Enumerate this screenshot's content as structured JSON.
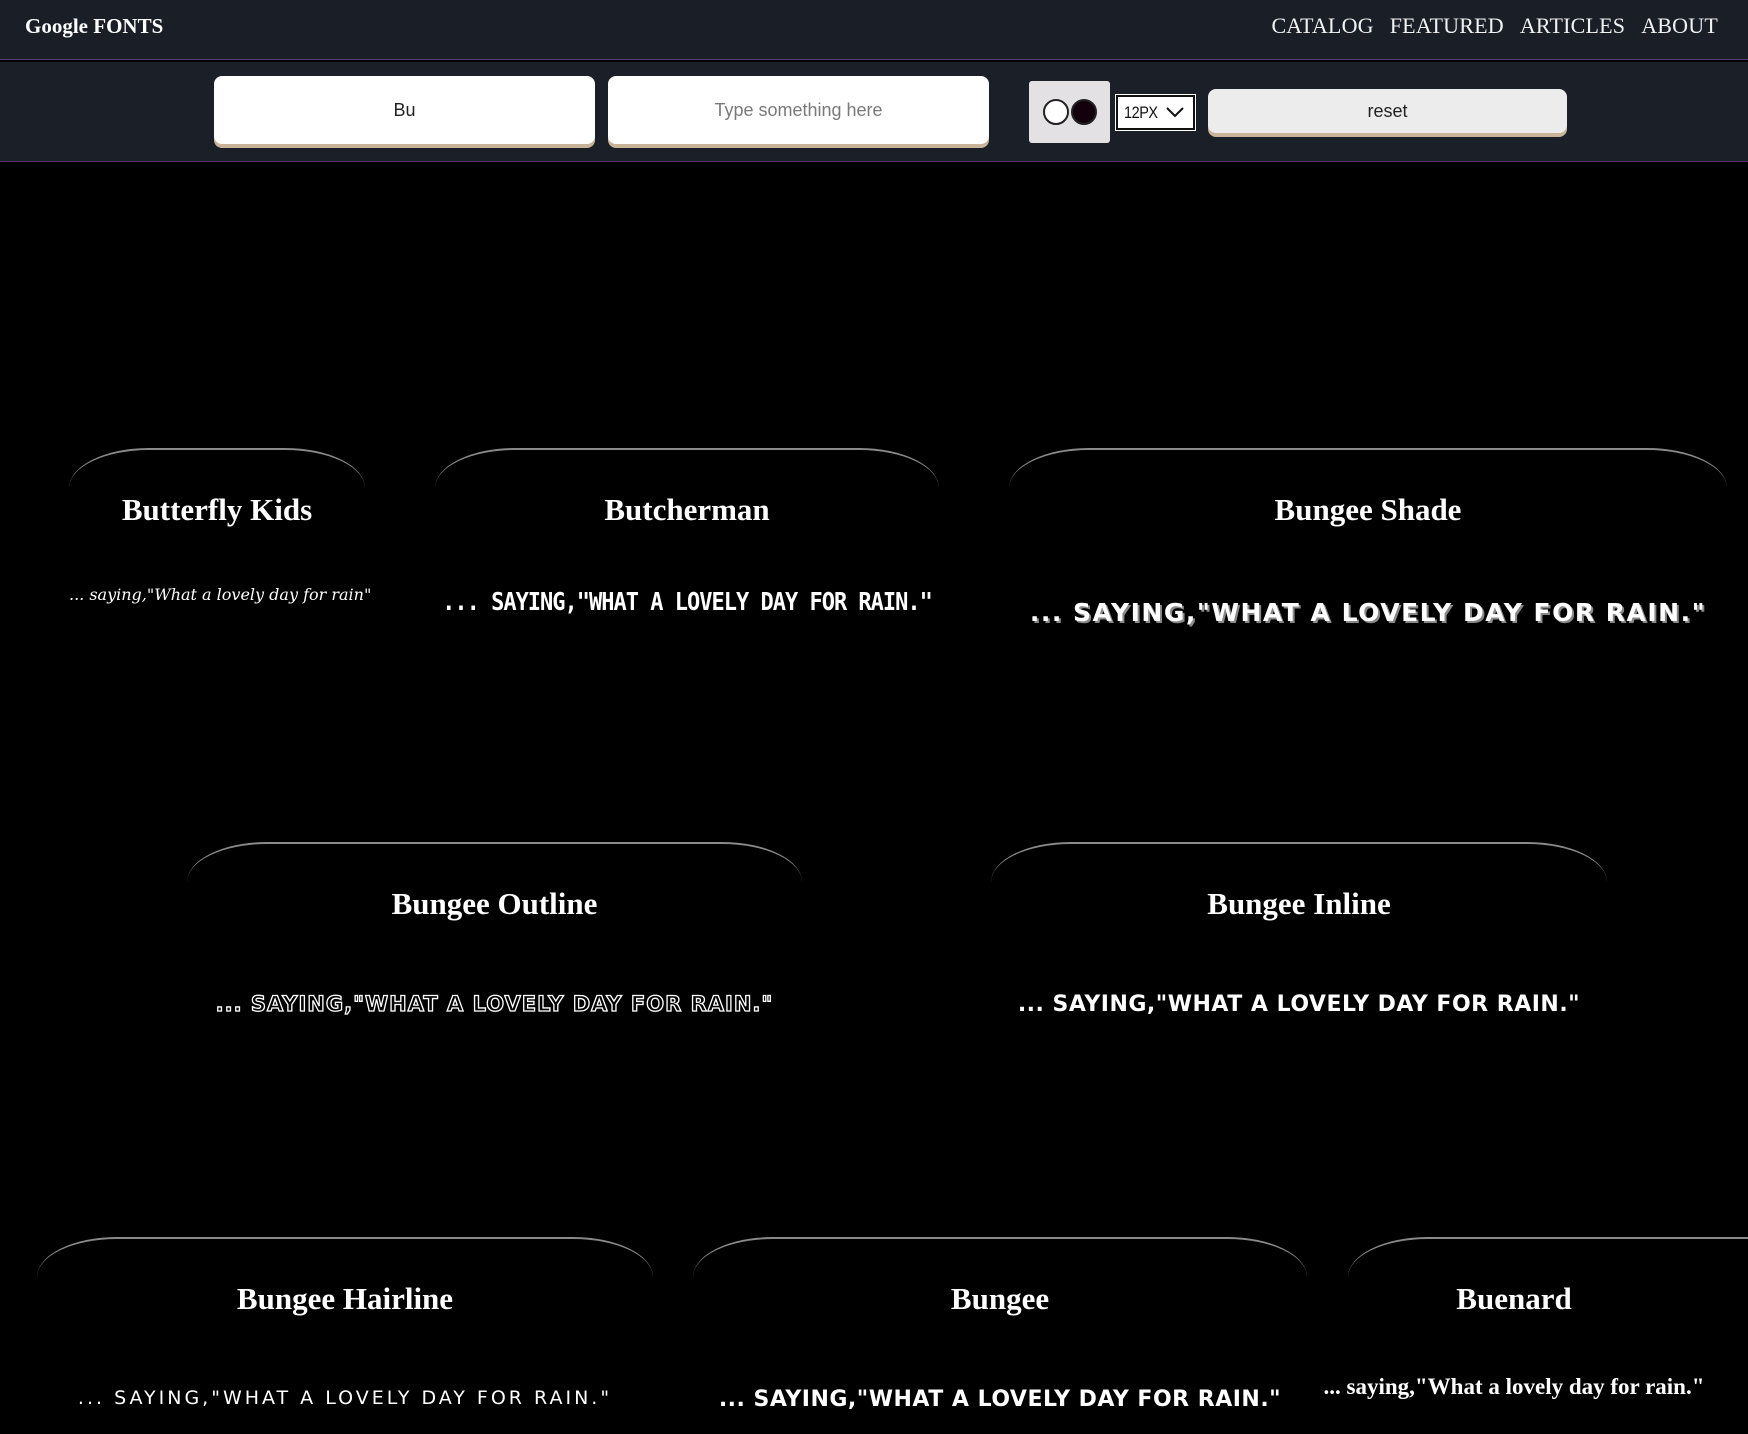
{
  "brand": "Google FONTS",
  "nav": [
    "CATALOG",
    "FEATURED",
    "ARTICLES",
    "ABOUT"
  ],
  "toolbar": {
    "family_value": "Bu",
    "sample_placeholder": "Type something here",
    "size_value": "12PX",
    "reset_label": "reset"
  },
  "cards": [
    {
      "name": "Butterfly Kids",
      "sample": "... saying,\"What a lovely day for rain\""
    },
    {
      "name": "Butcherman",
      "sample": "... SAYING,\"WHAT A LOVELY DAY FOR RAIN.\""
    },
    {
      "name": "Bungee Shade",
      "sample": "... SAYING,\"WHAT A LOVELY DAY FOR RAIN.\""
    },
    {
      "name": "Bungee Outline",
      "sample": "... SAYING,\"WHAT A LOVELY DAY FOR RAIN.\""
    },
    {
      "name": "Bungee Inline",
      "sample": "... SAYING,\"WHAT A LOVELY DAY FOR RAIN.\""
    },
    {
      "name": "Bungee Hairline",
      "sample": "... SAYING,\"WHAT A LOVELY DAY FOR RAIN.\""
    },
    {
      "name": "Bungee",
      "sample": "... SAYING,\"WHAT A LOVELY DAY FOR RAIN.\""
    },
    {
      "name": "Buenard",
      "sample": "... saying,\"What a lovely day for rain.\""
    }
  ]
}
